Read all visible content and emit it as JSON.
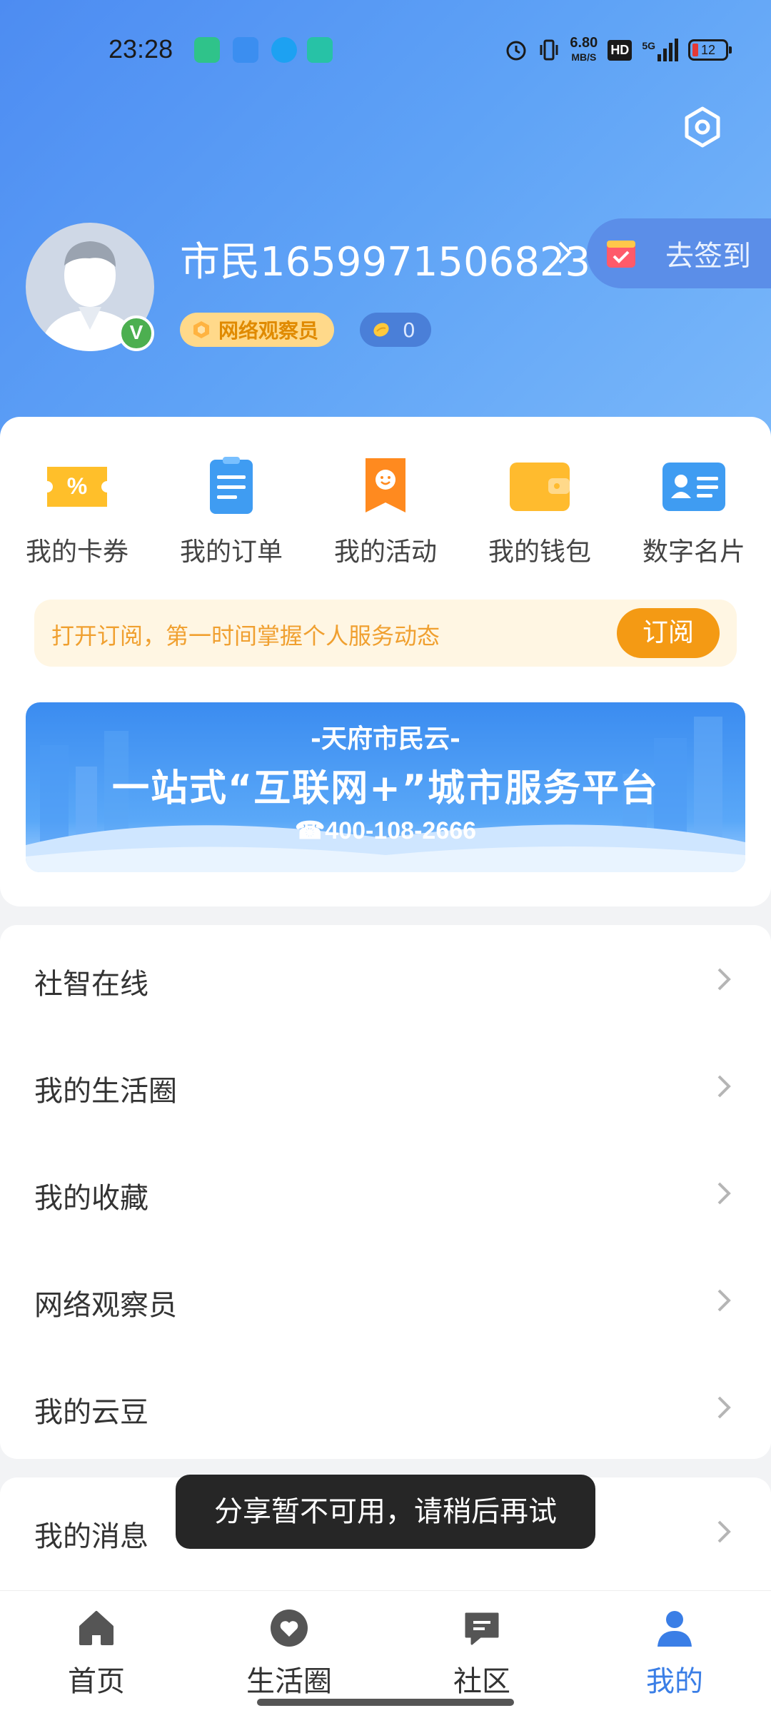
{
  "status_bar": {
    "time": "23:28",
    "net_speed": "6.80",
    "net_unit": "MB/S",
    "hd": "HD",
    "signal": "5G",
    "battery": "12"
  },
  "profile": {
    "username": "市民1659971506823",
    "verified_mark": "V",
    "checkin_label": "去签到",
    "observer_badge": "网络观察员",
    "beans_count": "0"
  },
  "quick_actions": [
    {
      "label": "我的卡券",
      "icon": "coupon-icon",
      "color": "#ffc02e"
    },
    {
      "label": "我的订单",
      "icon": "order-icon",
      "color": "#4aa3f5"
    },
    {
      "label": "我的活动",
      "icon": "activity-icon",
      "color": "#ff8a1f"
    },
    {
      "label": "我的钱包",
      "icon": "wallet-icon",
      "color": "#ffb92e"
    },
    {
      "label": "数字名片",
      "icon": "id-card-icon",
      "color": "#4aa3f5"
    }
  ],
  "subscribe": {
    "text": "打开订阅，第一时间掌握个人服务动态",
    "button": "订阅"
  },
  "banner": {
    "subtitle": "-天府市民云-",
    "title": "一站式“互联网+”城市服务平台",
    "phone": "☎400-108-2666"
  },
  "menu": [
    {
      "label": "社智在线"
    },
    {
      "label": "我的生活圈"
    },
    {
      "label": "我的收藏"
    },
    {
      "label": "网络观察员"
    },
    {
      "label": "我的云豆"
    }
  ],
  "menu2": {
    "label": "我的消息"
  },
  "toast": "分享暂不可用，请稍后再试",
  "bottom_nav": [
    {
      "label": "首页",
      "icon": "home-icon",
      "active": false
    },
    {
      "label": "生活圈",
      "icon": "heart-icon",
      "active": false
    },
    {
      "label": "社区",
      "icon": "chat-icon",
      "active": false
    },
    {
      "label": "我的",
      "icon": "person-icon",
      "active": true
    }
  ]
}
